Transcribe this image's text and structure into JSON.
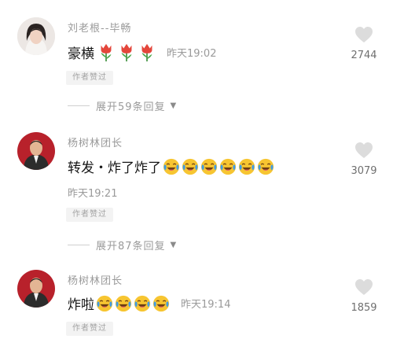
{
  "comments": [
    {
      "username": "刘老根--毕畅",
      "text": "豪横",
      "emoji": [
        "tulip-icon",
        "tulip-icon",
        "tulip-icon"
      ],
      "time": "昨天19:02",
      "badge": "作者赞过",
      "likes": "2744",
      "expand": "展开59条回复"
    },
    {
      "username": "杨树林团长",
      "text": "转发・炸了炸了",
      "emoji": [
        "laughing-crying-icon",
        "laughing-crying-icon",
        "laughing-crying-icon",
        "laughing-crying-icon",
        "laughing-crying-icon",
        "laughing-crying-icon"
      ],
      "time": "昨天19:21",
      "badge": "作者赞过",
      "likes": "3079",
      "expand": "展开87条回复"
    },
    {
      "username": "杨树林团长",
      "text": "炸啦",
      "emoji": [
        "laughing-crying-icon",
        "laughing-crying-icon",
        "laughing-crying-icon",
        "laughing-crying-icon"
      ],
      "time": "昨天19:14",
      "badge": "作者赞过",
      "likes": "1859"
    }
  ],
  "colors": {
    "tulip": "#e4463b",
    "emoji": "#f7c531",
    "tears": "#3f9be6",
    "like": "#dcdcdc"
  }
}
